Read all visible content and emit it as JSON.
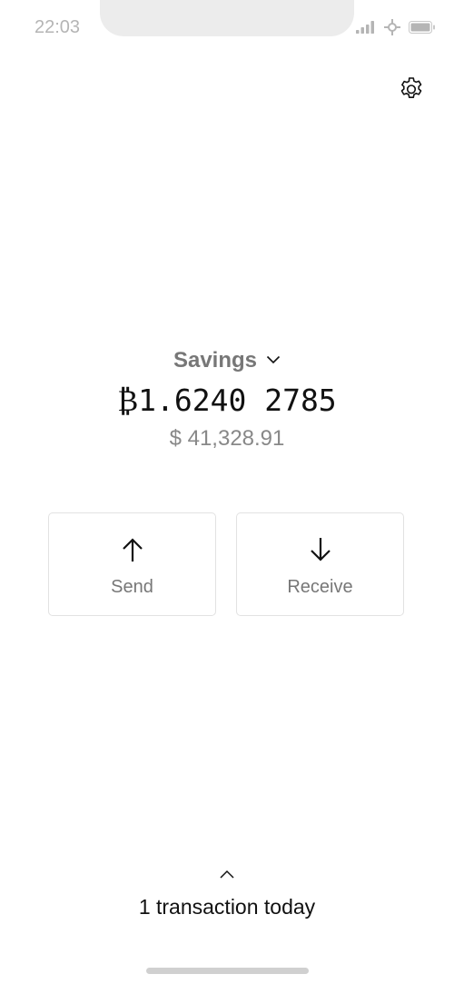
{
  "status_bar": {
    "time": "22:03",
    "icons": [
      "cellular-signal-icon",
      "tor-network-icon",
      "battery-icon"
    ]
  },
  "header": {
    "settings_icon": "gear-icon"
  },
  "wallet": {
    "name": "Savings",
    "selector_icon": "chevron-down-icon",
    "balance_btc": "₿1.6240 2785",
    "balance_usd": "$ 41,328.91"
  },
  "actions": {
    "send_label": "Send",
    "send_icon": "arrow-up-icon",
    "receive_label": "Receive",
    "receive_icon": "arrow-down-icon"
  },
  "transactions": {
    "expand_icon": "chevron-up-icon",
    "summary": "1 transaction today"
  },
  "colors": {
    "text_primary": "#111111",
    "text_secondary": "#777777",
    "border": "#e2e2e2",
    "status_gray": "#b5b5b5"
  }
}
